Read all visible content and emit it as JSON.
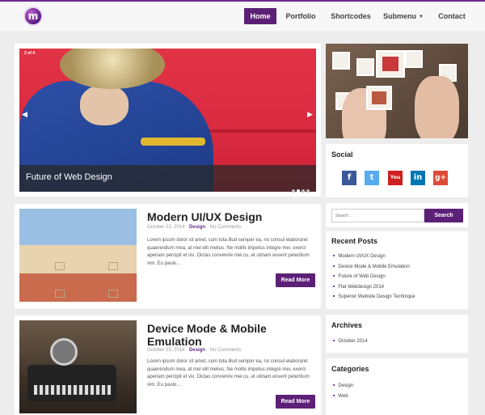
{
  "nav": {
    "logo_letter": "m",
    "items": [
      {
        "label": "Home",
        "active": true
      },
      {
        "label": "Portfolio"
      },
      {
        "label": "Shortcodes"
      },
      {
        "label": "Submenu"
      },
      {
        "label": "Contact"
      }
    ]
  },
  "slider": {
    "counter": "2 of 4",
    "caption": "Future of Web Design",
    "prev_icon": "chevron-left-icon",
    "next_icon": "chevron-right-icon",
    "slides_total": 4,
    "active_slide": 2
  },
  "posts": [
    {
      "title": "Modern UI/UX Design",
      "date": "October 23, 2014",
      "category": "Design",
      "comments": "No Comments",
      "excerpt": "Lorem ipsum dolor sit amet, cum tota illud semper ea, no consul elaboraret quaerendum mea, at mel elit melius. Ne mollis impetus integre mei, exerci aperiam percipit et vix. Dictas convenire mei cu, et utinam essent petentium vim. Eu paulo…",
      "button": "Read More"
    },
    {
      "title": "Device Mode & Mobile Emulation",
      "date": "October 23, 2014",
      "category": "Design",
      "comments": "No Comments",
      "excerpt": "Lorem ipsum dolor sit amet, cum tota illud semper ea, no consul elaboraret quaerendum mea, at mel elit melius. Ne mollis impetus integre mei, exerci aperiam percipit et vix. Dictas convenire mei cu, et utinam essent petentium vim. Eu paulo…",
      "button": "Read More"
    }
  ],
  "sidebar": {
    "social": {
      "heading": "Social",
      "icons": [
        "f",
        "t",
        "You",
        "in",
        "g+"
      ]
    },
    "search": {
      "placeholder": "Search …",
      "button": "Search"
    },
    "recent_posts": {
      "heading": "Recent Posts",
      "items": [
        "Modern UI/UX Design",
        "Device Mode & Mobile Emulation",
        "Future of Web Design",
        "Flat Webdesign 2014",
        "Superior Website Design Technique"
      ]
    },
    "archives": {
      "heading": "Archives",
      "items": [
        "October 2014"
      ]
    },
    "categories": {
      "heading": "Categories",
      "items": [
        "Design",
        "Web"
      ]
    }
  },
  "colors": {
    "accent": "#5c2077",
    "facebook": "#3b5998",
    "twitter": "#55acee",
    "youtube": "#cd201f",
    "linkedin": "#0077b5",
    "googleplus": "#dd4b39"
  }
}
